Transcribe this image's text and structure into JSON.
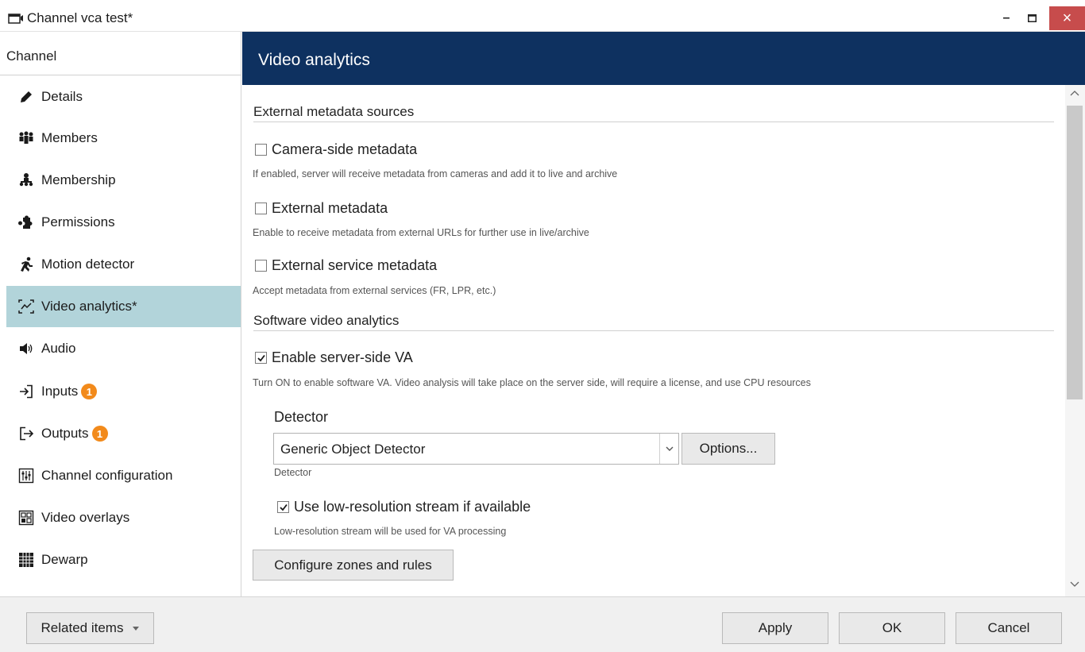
{
  "window": {
    "title": "Channel vca test*",
    "minimize_glyph": "–",
    "close_glyph": "×"
  },
  "sidebar": {
    "header": "Channel",
    "items": [
      {
        "label": "Details",
        "icon": "pencil-icon"
      },
      {
        "label": "Members",
        "icon": "members-icon"
      },
      {
        "label": "Membership",
        "icon": "membership-icon"
      },
      {
        "label": "Permissions",
        "icon": "permissions-icon"
      },
      {
        "label": "Motion detector",
        "icon": "running-man-icon"
      },
      {
        "label": "Video analytics*",
        "icon": "analytics-icon",
        "active": true
      },
      {
        "label": "Audio",
        "icon": "speaker-icon"
      },
      {
        "label": "Inputs",
        "icon": "input-icon",
        "badge": "1"
      },
      {
        "label": "Outputs",
        "icon": "output-icon",
        "badge": "1"
      },
      {
        "label": "Channel configuration",
        "icon": "sliders-icon"
      },
      {
        "label": "Video overlays",
        "icon": "overlay-icon"
      },
      {
        "label": "Dewarp",
        "icon": "dewarp-icon"
      }
    ]
  },
  "content": {
    "title": "Video analytics",
    "external_section": "External metadata sources",
    "camera_side": {
      "label": "Camera-side metadata",
      "checked": false,
      "hint": "If enabled, server will receive metadata from cameras and add it to live and archive"
    },
    "external_metadata": {
      "label": "External metadata",
      "checked": false,
      "hint": "Enable to receive metadata from external URLs for further use in live/archive"
    },
    "external_service": {
      "label": "External service metadata",
      "checked": false,
      "hint": "Accept metadata from external services (FR, LPR, etc.)"
    },
    "software_section": "Software video analytics",
    "server_side_va": {
      "label": "Enable server-side VA",
      "checked": true,
      "hint": "Turn ON to enable software VA. Video analysis will take place on the server side, will require a license, and use CPU resources"
    },
    "detector": {
      "label": "Detector",
      "value": "Generic Object Detector",
      "hint": "Detector",
      "options_button": "Options..."
    },
    "low_res": {
      "label": "Use low-resolution stream if available",
      "checked": true,
      "hint": "Low-resolution stream will be used for VA processing"
    },
    "configure_button": "Configure zones and rules"
  },
  "footer": {
    "related_items": "Related items",
    "apply": "Apply",
    "ok": "OK",
    "cancel": "Cancel"
  },
  "colors": {
    "header_bg": "#0e3160",
    "active_item_bg": "#b2d4da",
    "badge_bg": "#f28a1b",
    "close_bg": "#c74c4c"
  }
}
